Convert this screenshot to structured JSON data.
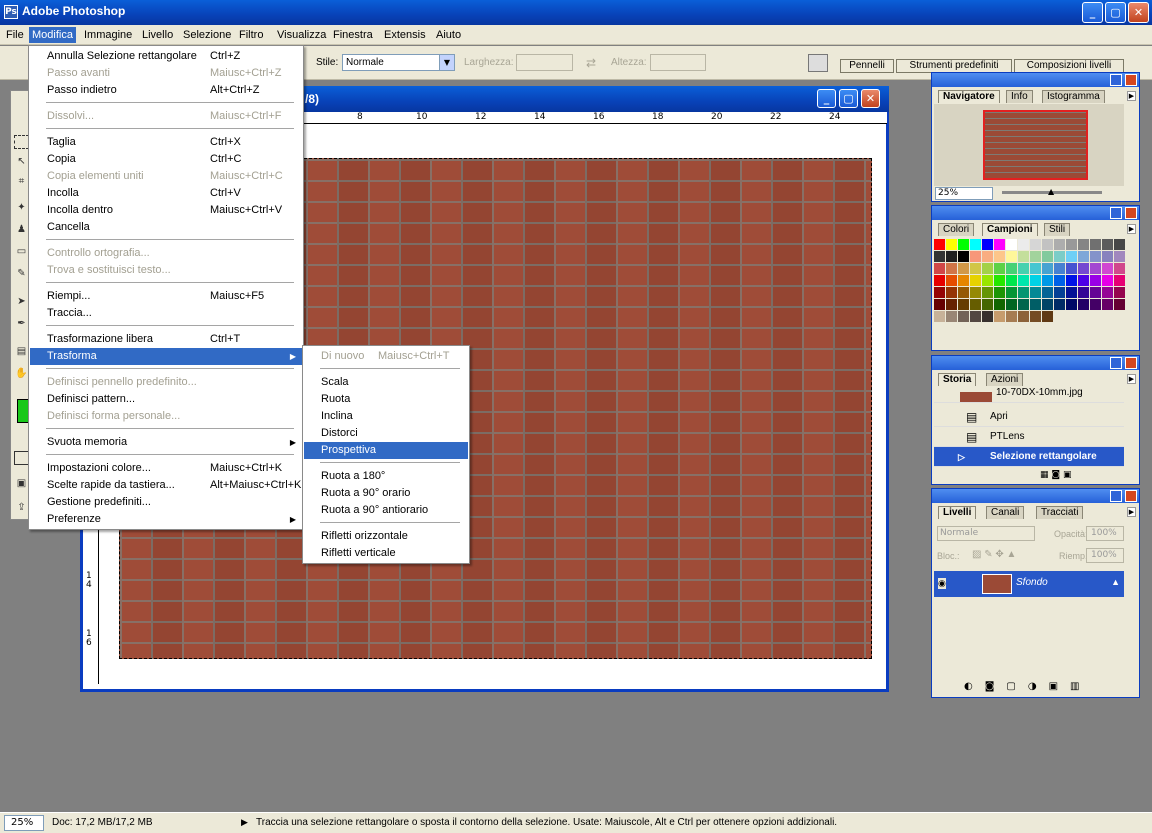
{
  "app": {
    "title": "Adobe Photoshop",
    "icon": "photoshop-icon",
    "icon_glyph": "Ps"
  },
  "window_controls": {
    "minimize": "_",
    "maximize": "▢",
    "close": "✕"
  },
  "menubar": [
    "File",
    "Modifica",
    "Immagine",
    "Livello",
    "Selezione",
    "Filtro",
    "Visualizza",
    "Finestra",
    "Extensis",
    "Aiuto"
  ],
  "options": {
    "style_label": "Stile:",
    "style_value": "Normale",
    "width_label": "Larghezza:",
    "height_label": "Altezza:",
    "swap_glyph": "⇄",
    "wells": [
      "Pennelli",
      "Strumenti predefiniti",
      "Composizioni livelli"
    ]
  },
  "document": {
    "title_fragment": "/8)",
    "ruler_h": [
      "8",
      "10",
      "12",
      "14",
      "16",
      "18",
      "20",
      "22",
      "24"
    ],
    "ruler_v": [
      "1 4",
      "1 6"
    ]
  },
  "menu_modifica": [
    {
      "label": "Annulla Selezione rettangolare",
      "shortcut": "Ctrl+Z",
      "disabled": false
    },
    {
      "label": "Passo avanti",
      "shortcut": "Maiusc+Ctrl+Z",
      "disabled": true
    },
    {
      "label": "Passo indietro",
      "shortcut": "Alt+Ctrl+Z",
      "disabled": false
    },
    {
      "sep": true
    },
    {
      "label": "Dissolvi...",
      "shortcut": "Maiusc+Ctrl+F",
      "disabled": true
    },
    {
      "sep": true
    },
    {
      "label": "Taglia",
      "shortcut": "Ctrl+X",
      "disabled": false
    },
    {
      "label": "Copia",
      "shortcut": "Ctrl+C",
      "disabled": false
    },
    {
      "label": "Copia elementi uniti",
      "shortcut": "Maiusc+Ctrl+C",
      "disabled": true
    },
    {
      "label": "Incolla",
      "shortcut": "Ctrl+V",
      "disabled": false
    },
    {
      "label": "Incolla dentro",
      "shortcut": "Maiusc+Ctrl+V",
      "disabled": false
    },
    {
      "label": "Cancella",
      "shortcut": "",
      "disabled": false
    },
    {
      "sep": true
    },
    {
      "label": "Controllo ortografia...",
      "shortcut": "",
      "disabled": true
    },
    {
      "label": "Trova e sostituisci testo...",
      "shortcut": "",
      "disabled": true
    },
    {
      "sep": true
    },
    {
      "label": "Riempi...",
      "shortcut": "Maiusc+F5",
      "disabled": false
    },
    {
      "label": "Traccia...",
      "shortcut": "",
      "disabled": false
    },
    {
      "sep": true
    },
    {
      "label": "Trasformazione libera",
      "shortcut": "Ctrl+T",
      "disabled": false
    },
    {
      "label": "Trasforma",
      "shortcut": "",
      "disabled": false,
      "submenu": true,
      "selected": true
    },
    {
      "sep": true
    },
    {
      "label": "Definisci pennello predefinito...",
      "shortcut": "",
      "disabled": true
    },
    {
      "label": "Definisci pattern...",
      "shortcut": "",
      "disabled": false
    },
    {
      "label": "Definisci forma personale...",
      "shortcut": "",
      "disabled": true
    },
    {
      "sep": true
    },
    {
      "label": "Svuota memoria",
      "shortcut": "",
      "disabled": false,
      "submenu": true
    },
    {
      "sep": true
    },
    {
      "label": "Impostazioni colore...",
      "shortcut": "Maiusc+Ctrl+K",
      "disabled": false
    },
    {
      "label": "Scelte rapide da tastiera...",
      "shortcut": "Alt+Maiusc+Ctrl+K",
      "disabled": false
    },
    {
      "label": "Gestione predefiniti...",
      "shortcut": "",
      "disabled": false
    },
    {
      "label": "Preferenze",
      "shortcut": "",
      "disabled": false,
      "submenu": true
    }
  ],
  "menu_trasforma": [
    {
      "label": "Di nuovo",
      "shortcut": "Maiusc+Ctrl+T",
      "disabled": true
    },
    {
      "sep": true
    },
    {
      "label": "Scala",
      "disabled": false
    },
    {
      "label": "Ruota",
      "disabled": false
    },
    {
      "label": "Inclina",
      "disabled": false
    },
    {
      "label": "Distorci",
      "disabled": false
    },
    {
      "label": "Prospettiva",
      "disabled": false,
      "selected": true
    },
    {
      "sep": true
    },
    {
      "label": "Ruota a 180°",
      "disabled": false
    },
    {
      "label": "Ruota a 90° orario",
      "disabled": false
    },
    {
      "label": "Ruota a 90° antiorario",
      "disabled": false
    },
    {
      "sep": true
    },
    {
      "label": "Rifletti orizzontale",
      "disabled": false
    },
    {
      "label": "Rifletti verticale",
      "disabled": false
    }
  ],
  "navigator": {
    "tabs": [
      "Navigatore",
      "Info",
      "Istogramma"
    ],
    "zoom": "25%"
  },
  "swatches_panel": {
    "tabs": [
      "Colori",
      "Campioni",
      "Stili"
    ]
  },
  "history": {
    "tabs": [
      "Storia",
      "Azioni"
    ],
    "snapshot": "10-70DX-10mm.jpg",
    "items": [
      "Apri",
      "PTLens",
      "Selezione rettangolare"
    ]
  },
  "layers": {
    "tabs": [
      "Livelli",
      "Canali",
      "Tracciati"
    ],
    "blend": "Normale",
    "opacity_label": "Opacità:",
    "opacity": "100%",
    "lock_label": "Bloc.:",
    "fill_label": "Riemp.:",
    "fill": "100%",
    "layer_name": "Sfondo"
  },
  "status": {
    "zoom": "25%",
    "doc": "Doc: 17,2 MB/17,2 MB",
    "hint": "Traccia una selezione rettangolare o sposta il contorno della selezione.  Usate: Maiuscole, Alt e Ctrl per ottenere opzioni addizionali."
  },
  "colors": {
    "foreground": "#19c819",
    "selection": "#316ac5",
    "title": "#0842b8"
  }
}
